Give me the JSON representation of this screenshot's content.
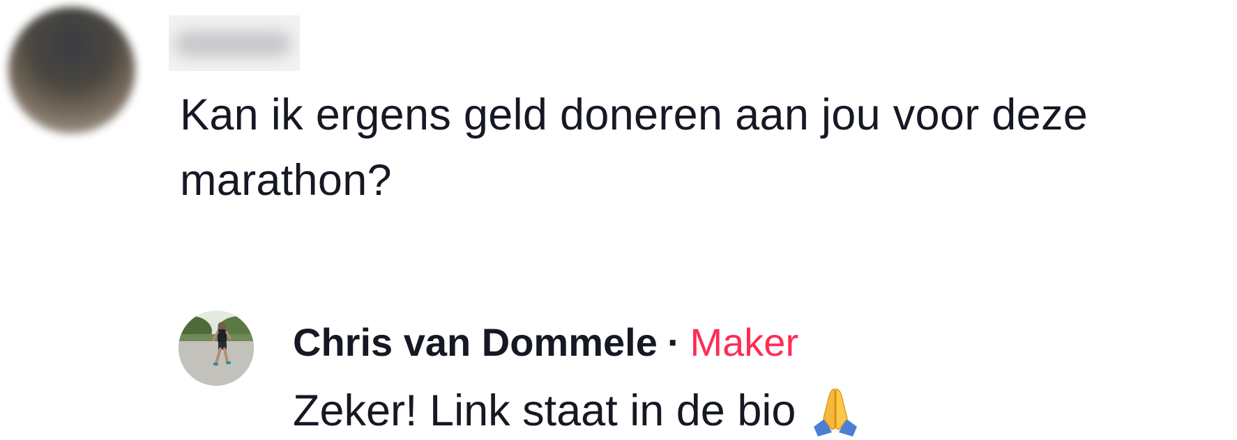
{
  "comment": {
    "username": "",
    "text": "Kan ik ergens geld doneren aan jou voor deze marathon?"
  },
  "reply": {
    "author": "Chris van Dommele",
    "separator": "·",
    "badge": "Maker",
    "text": "Zeker! Link staat in de bio",
    "emoji_icon": "folded-hands-icon"
  },
  "colors": {
    "text": "#161823",
    "creator_badge": "#fe2c55",
    "background": "#ffffff"
  }
}
